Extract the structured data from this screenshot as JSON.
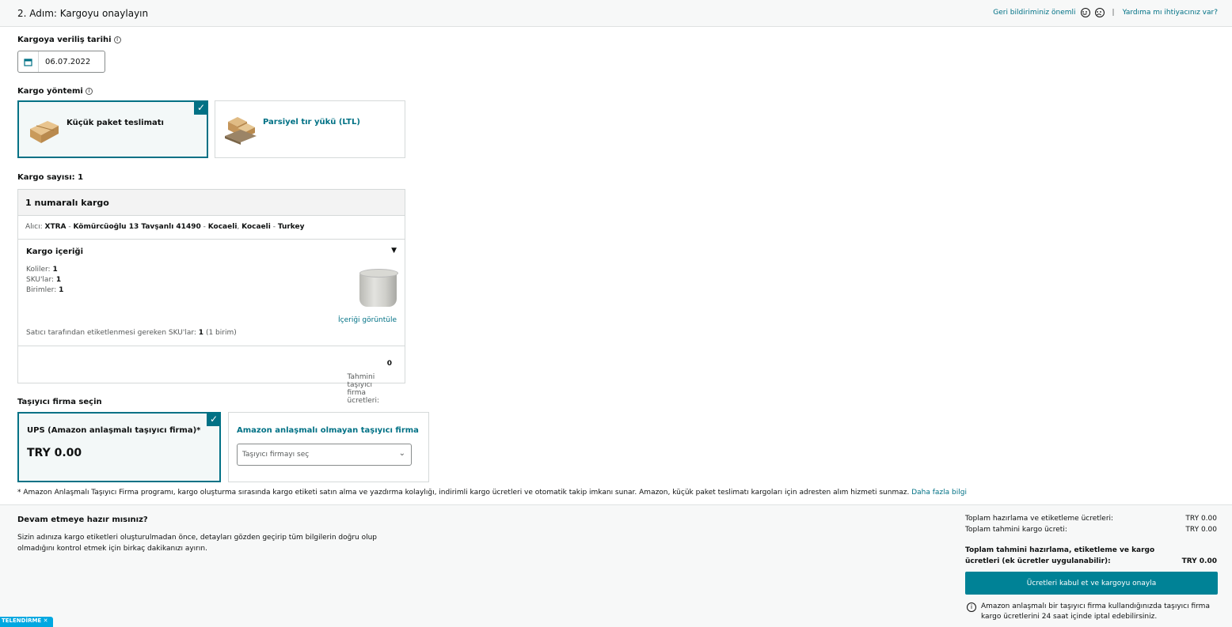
{
  "header": {
    "step_title": "2. Adım: Kargoyu onaylayın",
    "feedback_text": "Geri bildiriminiz önemli",
    "separator": "|",
    "help_link": "Yardıma mı ihtiyacınız var?"
  },
  "ship_date": {
    "label": "Kargoya veriliş tarihi",
    "value": "06.07.2022"
  },
  "method": {
    "label": "Kargo yöntemi",
    "options": [
      {
        "label": "Küçük paket teslimatı",
        "selected": true
      },
      {
        "label": "Parsiyel tır yükü (LTL)",
        "selected": false
      }
    ]
  },
  "shipment_count": {
    "label": "Kargo sayısı:",
    "value": "1"
  },
  "shipment": {
    "title": "1 numaralı kargo",
    "recipient_label": "Alıcı:",
    "recipient": "XTRA",
    "address": "Kömürcüoğlu 13 Tavşanlı 41490",
    "city": "Kocaeli",
    "region": "Kocaeli",
    "country": "Turkey",
    "contents_title": "Kargo içeriği",
    "boxes_label": "Koliler:",
    "boxes": "1",
    "skus_label": "SKU'lar:",
    "skus": "1",
    "units_label": "Birimler:",
    "units": "1",
    "view_contents": "İçeriği görüntüle",
    "label_note": "Satıcı tarafından etiketlenmesi gereken SKU'lar:",
    "label_count": "1",
    "label_units": "(1 birim)",
    "estimate_label": "Tahmini taşıyıcı firma ücretleri:",
    "estimate_value": "0"
  },
  "carrier": {
    "label": "Taşıyıcı firma seçin",
    "ups_name": "UPS (Amazon anlaşmalı taşıyıcı firma)*",
    "ups_price": "TRY 0.00",
    "other_name": "Amazon anlaşmalı olmayan taşıyıcı firma",
    "select_placeholder": "Taşıyıcı firmayı seç"
  },
  "footnote": {
    "text": "* Amazon Anlaşmalı Taşıyıcı Firma programı, kargo oluşturma sırasında kargo etiketi satın alma ve yazdırma kolaylığı, indirimli kargo ücretleri ve otomatik takip imkanı sunar. Amazon, küçük paket teslimatı kargoları için adresten alım hizmeti sunmaz.",
    "link": "Daha fazla bilgi"
  },
  "footer": {
    "title": "Devam etmeye hazır mısınız?",
    "text": "Sizin adınıza kargo etiketleri oluşturulmadan önce, detayları gözden geçirip tüm bilgilerin doğru olup olmadığını kontrol etmek için birkaç dakikanızı ayırın.",
    "prep_label": "Toplam hazırlama ve etiketleme ücretleri:",
    "prep_value": "TRY 0.00",
    "ship_label": "Toplam tahmini kargo ücreti:",
    "ship_value": "TRY 0.00",
    "total_label": "Toplam tahmini hazırlama, etiketleme ve kargo ücretleri (ek ücretler uygulanabilir):",
    "total_value": "TRY 0.00",
    "confirm_button": "Ücretleri kabul et ve kargoyu onayla",
    "cancel_note": "Amazon anlaşmalı bir taşıyıcı firma kullandığınızda taşıyıcı firma kargo ücretlerini 24 saat içinde iptal edebilirsiniz."
  },
  "feedback_tab": "TELENDİRME ✕",
  "colors": {
    "accent": "#007185",
    "button": "#008296",
    "selected_bg": "#f3f8f8"
  }
}
